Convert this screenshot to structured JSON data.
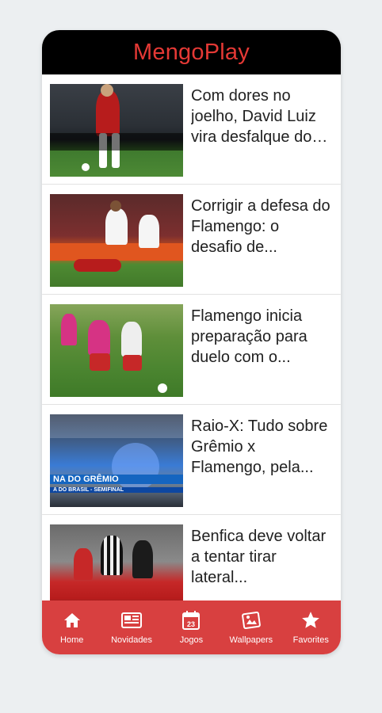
{
  "app": {
    "title": "MengoPlay"
  },
  "feed": {
    "items": [
      {
        "title": "Com dores no joelho, David Luiz vira desfalque do Flamengo",
        "display_title": "Com dores no joelho, David Luiz vira desfalque d..."
      },
      {
        "title": "Corrigir a defesa do Flamengo: o desafio de...",
        "display_title": "Corrigir a defesa do Flamengo: o desafio de..."
      },
      {
        "title": "Flamengo inicia preparação para duelo com o...",
        "display_title": "Flamengo inicia preparação para duelo com o..."
      },
      {
        "title": "Raio-X: Tudo sobre Grêmio x Flamengo, pela...",
        "display_title": "Raio-X: Tudo sobre Grêmio x Flamengo, pela..."
      },
      {
        "title": "Benfica deve voltar a tentar tirar lateral...",
        "display_title": "Benfica deve voltar a tentar tirar lateral..."
      }
    ],
    "thumb_texts": {
      "t4_banner": "NA DO GRÊMIO",
      "t4_sub": "A DO BRASIL - SEMIFINAL"
    }
  },
  "bottom_nav": {
    "items": [
      {
        "label": "Home",
        "icon": "home-icon"
      },
      {
        "label": "Novidades",
        "icon": "news-icon"
      },
      {
        "label": "Jogos",
        "icon": "calendar-icon"
      },
      {
        "label": "Wallpapers",
        "icon": "wallpaper-icon"
      },
      {
        "label": "Favorites",
        "icon": "star-icon"
      }
    ]
  },
  "colors": {
    "header_bg": "#000000",
    "title_color": "#e53935",
    "nav_bg": "#d84040",
    "page_bg": "#eceff1"
  }
}
